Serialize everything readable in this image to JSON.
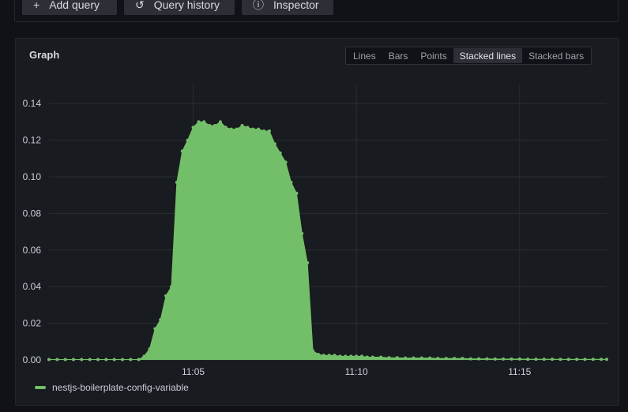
{
  "toolbar": {
    "add_query_label": "Add query",
    "query_history_label": "Query history",
    "inspector_label": "Inspector",
    "add_icon": "plus-icon",
    "history_icon": "history-icon",
    "inspector_icon": "info-icon"
  },
  "panel": {
    "title": "Graph",
    "view_options": [
      "Lines",
      "Bars",
      "Points",
      "Stacked lines",
      "Stacked bars"
    ],
    "selected_view": "Stacked lines"
  },
  "legend": {
    "series_name": "nestjs-boilerplate-config-variable",
    "color": "#73bf69"
  },
  "chart_data": {
    "type": "area",
    "title": "",
    "xlabel": "",
    "ylabel": "",
    "x_ticks": [
      "11:05",
      "11:10",
      "11:15"
    ],
    "y_ticks": [
      "0.00",
      "0.02",
      "0.04",
      "0.06",
      "0.08",
      "0.10",
      "0.12",
      "0.14"
    ],
    "ylim": [
      0,
      0.15
    ],
    "x_unit": "minutes",
    "xlim": [
      "11:00:35",
      "11:17:40"
    ],
    "grid": true,
    "series": [
      {
        "name": "nestjs-boilerplate-config-variable",
        "color": "#73bf69",
        "x": [
          "11:00:35",
          "11:00:50",
          "11:01:05",
          "11:01:20",
          "11:01:35",
          "11:01:50",
          "11:02:05",
          "11:02:20",
          "11:02:35",
          "11:02:50",
          "11:03:05",
          "11:03:20",
          "11:03:30",
          "11:03:40",
          "11:03:50",
          "11:04:00",
          "11:04:10",
          "11:04:20",
          "11:04:30",
          "11:04:40",
          "11:04:50",
          "11:05:00",
          "11:05:10",
          "11:05:20",
          "11:05:30",
          "11:05:40",
          "11:05:50",
          "11:06:00",
          "11:06:10",
          "11:06:20",
          "11:06:30",
          "11:06:40",
          "11:06:50",
          "11:07:00",
          "11:07:10",
          "11:07:20",
          "11:07:30",
          "11:07:40",
          "11:07:50",
          "11:08:00",
          "11:08:10",
          "11:08:20",
          "11:08:30",
          "11:08:40",
          "11:08:50",
          "11:09:00",
          "11:09:10",
          "11:09:20",
          "11:09:30",
          "11:09:40",
          "11:09:50",
          "11:10:00",
          "11:10:10",
          "11:10:20",
          "11:10:30",
          "11:10:45",
          "11:11:00",
          "11:11:15",
          "11:11:30",
          "11:11:45",
          "11:12:00",
          "11:12:15",
          "11:12:30",
          "11:12:45",
          "11:13:00",
          "11:13:15",
          "11:13:30",
          "11:13:45",
          "11:14:00",
          "11:14:15",
          "11:14:30",
          "11:14:45",
          "11:15:00",
          "11:15:15",
          "11:15:30",
          "11:15:45",
          "11:16:00",
          "11:16:15",
          "11:16:30",
          "11:16:45",
          "11:17:00",
          "11:17:15",
          "11:17:30",
          "11:17:40"
        ],
        "values": [
          0.0002,
          0.0002,
          0.0002,
          0.0002,
          0.0002,
          0.0002,
          0.0002,
          0.0002,
          0.0002,
          0.0002,
          0.0002,
          0.0002,
          0.002,
          0.006,
          0.017,
          0.022,
          0.035,
          0.04,
          0.097,
          0.114,
          0.12,
          0.127,
          0.13,
          0.13,
          0.128,
          0.128,
          0.13,
          0.127,
          0.126,
          0.126,
          0.128,
          0.127,
          0.126,
          0.126,
          0.125,
          0.125,
          0.118,
          0.113,
          0.108,
          0.097,
          0.091,
          0.069,
          0.053,
          0.005,
          0.003,
          0.0025,
          0.0025,
          0.0025,
          0.002,
          0.002,
          0.002,
          0.002,
          0.002,
          0.0015,
          0.0015,
          0.0015,
          0.0012,
          0.0012,
          0.001,
          0.001,
          0.001,
          0.001,
          0.0008,
          0.0008,
          0.0008,
          0.0008,
          0.0006,
          0.0006,
          0.0006,
          0.0005,
          0.0005,
          0.0005,
          0.0005,
          0.0004,
          0.0004,
          0.0004,
          0.0004,
          0.0003,
          0.0003,
          0.0003,
          0.0003,
          0.0003,
          0.0003,
          0.0003
        ]
      }
    ]
  }
}
